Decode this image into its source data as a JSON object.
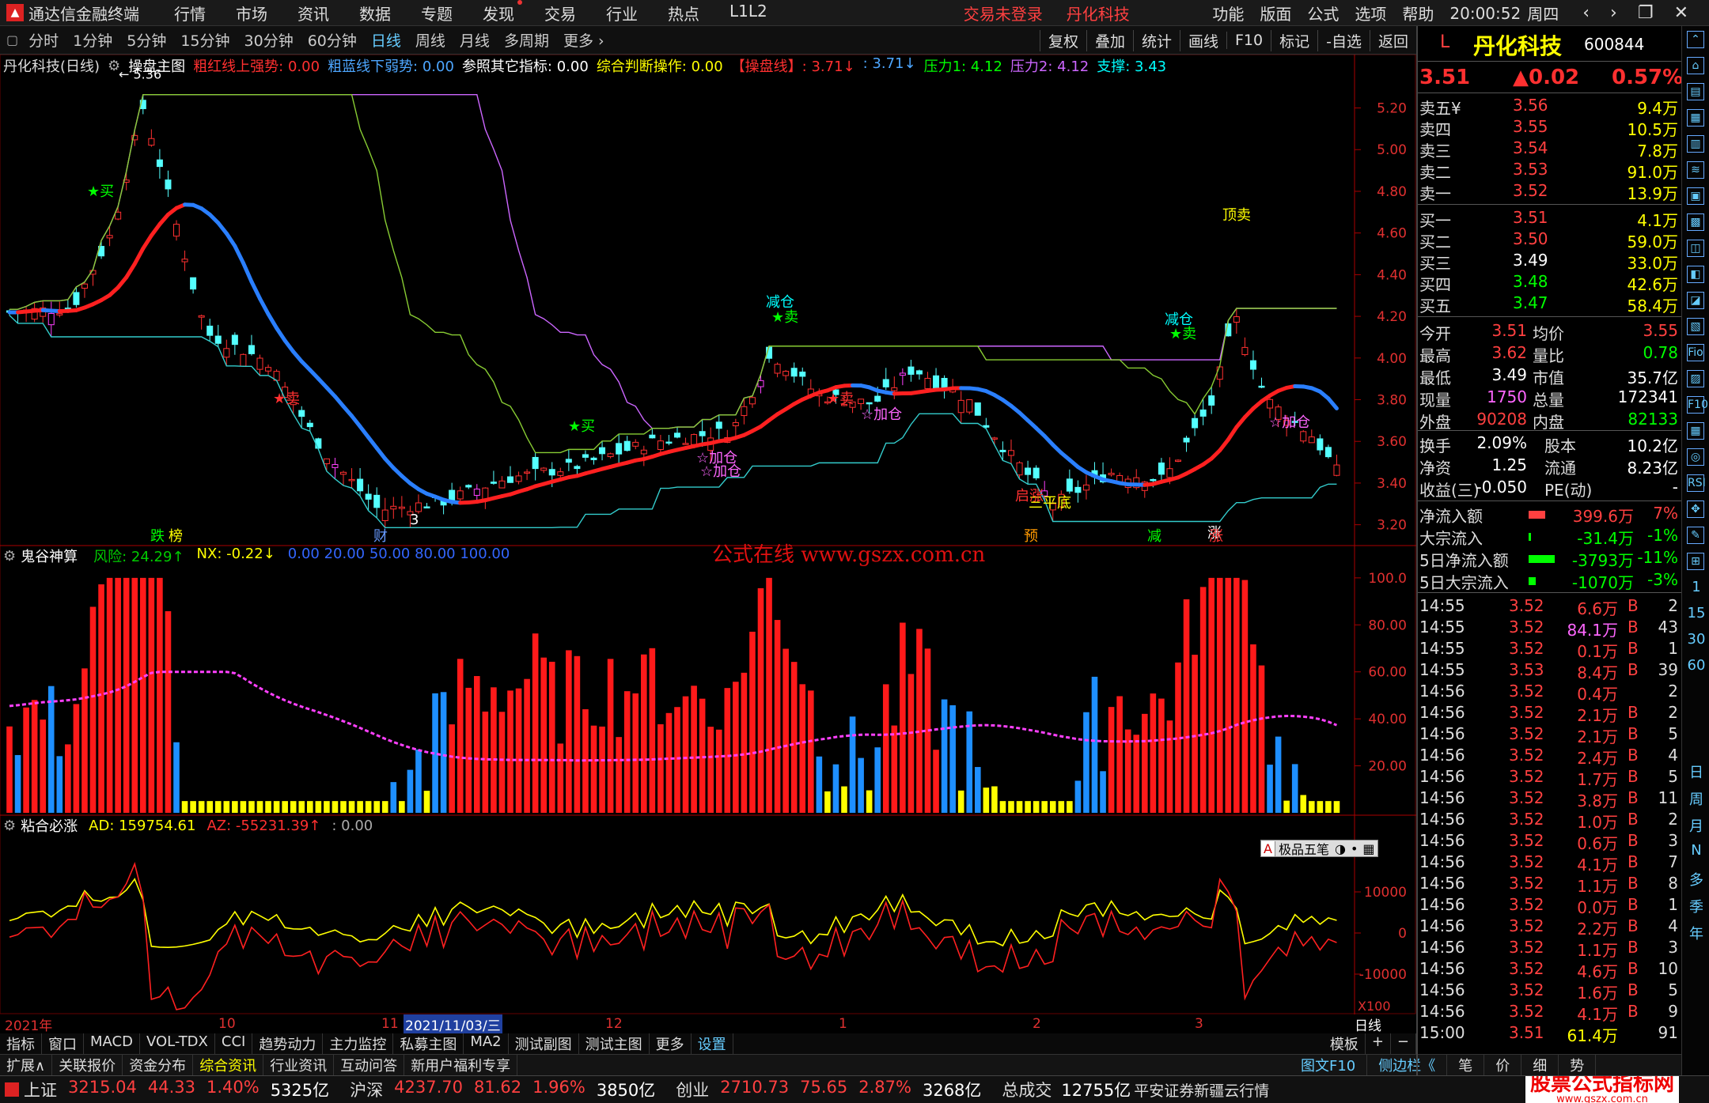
{
  "menubar": {
    "appname": "通达信金融终端",
    "items": [
      "行情",
      "市场",
      "资讯",
      "数据",
      "专题",
      "发现",
      "交易",
      "行业",
      "热点",
      "L1L2"
    ],
    "status_login": "交易未登录",
    "status_stock": "丹化科技",
    "right": [
      "功能",
      "版面",
      "公式",
      "选项",
      "帮助"
    ],
    "time": "20:00:52",
    "weekday": "周四",
    "controls": [
      "‹",
      "›",
      "❐",
      "✕"
    ]
  },
  "periodbar": {
    "items": [
      "分时",
      "1分钟",
      "5分钟",
      "15分钟",
      "30分钟",
      "60分钟",
      "日线",
      "周线",
      "月线",
      "多周期",
      "更多 ›"
    ],
    "active": "日线",
    "tools": [
      "复权",
      "叠加",
      "统计",
      "画线",
      "F10",
      "标记",
      "-自选",
      "返回"
    ]
  },
  "mainhdr": {
    "stock": "丹化科技(日线)",
    "formula": "操盘主图",
    "items": [
      {
        "t": "粗红线上强势: 0.00",
        "c": "#ff3030"
      },
      {
        "t": "粗蓝线下弱势: 0.00",
        "c": "#4da6ff"
      },
      {
        "t": "参照其它指标: 0.00",
        "c": "#ffffff"
      },
      {
        "t": "综合判断操作: 0.00",
        "c": "#ffff00"
      },
      {
        "t": "【操盘线】: 3.71↓",
        "c": "#ff3030"
      },
      {
        "t": ": 3.71↓",
        "c": "#4da6ff"
      },
      {
        "t": "压力1: 4.12",
        "c": "#00ff00"
      },
      {
        "t": "压力2: 4.12",
        "c": "#cc66ff"
      },
      {
        "t": "支撑: 3.43",
        "c": "#00ffff"
      }
    ]
  },
  "main_chart": {
    "y_ticks": [
      "5.20",
      "5.00",
      "4.80",
      "4.60",
      "4.40",
      "4.20",
      "4.00",
      "3.80",
      "3.60",
      "3.40",
      "3.20"
    ],
    "y_min": 3.1,
    "y_max": 5.35,
    "high_label": "5.36",
    "low_label": "3",
    "annotations": [
      {
        "t": "★买",
        "c": "#00ff00"
      },
      {
        "t": "★卖",
        "c": "#ff3030"
      },
      {
        "t": "★买",
        "c": "#00ff00"
      },
      {
        "t": "☆加仓",
        "c": "#ff66ff"
      },
      {
        "t": "☆加仓",
        "c": "#ff66ff"
      },
      {
        "t": "减仓",
        "c": "#00ffff"
      },
      {
        "t": "★卖",
        "c": "#00ff00"
      },
      {
        "t": "★卖",
        "c": "#ff3030"
      },
      {
        "t": "☆加仓",
        "c": "#ff66ff"
      },
      {
        "t": "三平底",
        "c": "#ffff00"
      },
      {
        "t": "减仓",
        "c": "#00ffff"
      },
      {
        "t": "★卖",
        "c": "#00ff00"
      },
      {
        "t": "顶卖",
        "c": "#ffff00"
      },
      {
        "t": "☆加仓",
        "c": "#ff66ff"
      },
      {
        "t": "启涨",
        "c": "#ff3030"
      },
      {
        "t": "3",
        "c": "#ffffff"
      },
      {
        "t": "涨",
        "c": "#ffffff"
      }
    ],
    "bottom_tags": [
      {
        "t": "跌",
        "c": "#00ff00"
      },
      {
        "t": "榜",
        "c": "#ffff00"
      },
      {
        "t": "财",
        "c": "#6699ff"
      },
      {
        "t": "预",
        "c": "#ff9900"
      },
      {
        "t": "减",
        "c": "#00ff00"
      },
      {
        "t": "涨",
        "c": "#ff3030"
      }
    ]
  },
  "osc1hdr": {
    "name": "鬼谷神算",
    "items": [
      {
        "t": "风险: 24.29↑",
        "c": "#00cc00"
      },
      {
        "t": "NX: -0.22↓",
        "c": "#ffff00"
      },
      {
        "t": "0.00  20.00  50.00  80.00  100.00",
        "c": "#3366ff"
      }
    ],
    "y_ticks": [
      "100.0",
      "80.00",
      "60.00",
      "40.00",
      "20.00"
    ],
    "watermark": "公式在线  www.gszx.com.cn"
  },
  "osc2hdr": {
    "name": "粘合必涨",
    "items": [
      {
        "t": "AD: 159754.61",
        "c": "#ffff00"
      },
      {
        "t": "AZ: -55231.39↑",
        "c": "#ff3030"
      },
      {
        "t": ": 0.00",
        "c": "#aaaaaa"
      }
    ],
    "y_ticks": [
      "10000",
      "0",
      "-10000"
    ],
    "unit": "X100",
    "popup": "极品五笔"
  },
  "datebar": {
    "labels": [
      "2021年",
      "10",
      "11",
      "2021/11/03/三",
      "12",
      "1",
      "2",
      "3"
    ],
    "right": "日线"
  },
  "bottomtabs": {
    "items": [
      "指标",
      "窗口",
      "MACD",
      "VOL-TDX",
      "CCI",
      "趋势动力",
      "主力监控",
      "私募主图",
      "MA2",
      "测试副图",
      "测试主图",
      "更多",
      "设置"
    ],
    "active": "设置",
    "right": [
      "模板",
      "+",
      "−"
    ]
  },
  "bottomtabs2": {
    "items": [
      "扩展∧",
      "关联报价",
      "资金分布",
      "综合资讯",
      "行业资讯",
      "互动问答",
      "新用户福利专享"
    ],
    "active": "综合资讯",
    "right": [
      "图文F10",
      "侧边栏《",
      "笔",
      "价",
      "细",
      "势"
    ]
  },
  "indexbar": {
    "items": [
      {
        "name": "上证",
        "v": "3215.04",
        "d": "44.33",
        "p": "1.40%",
        "a": "5325亿"
      },
      {
        "name": "沪深",
        "v": "4237.70",
        "d": "81.62",
        "p": "1.96%",
        "a": "3850亿"
      },
      {
        "name": "创业",
        "v": "2710.73",
        "d": "75.65",
        "p": "2.87%",
        "a": "3268亿"
      }
    ],
    "total_label": "总成交",
    "total": "12755亿",
    "broker": "平安证券新疆云行情",
    "brand": "股票公式指标网",
    "brand_url": "www.gszx.com.cn"
  },
  "quote": {
    "name": "丹化科技",
    "code": "600844",
    "flag": "L",
    "price": "3.51",
    "change": "▲0.02",
    "pct": "0.57%",
    "asks": [
      {
        "l": "卖五¥",
        "p": "3.56",
        "v": "9.4万",
        "c": "#ff4040"
      },
      {
        "l": "卖四",
        "p": "3.55",
        "v": "10.5万",
        "c": "#ff4040"
      },
      {
        "l": "卖三",
        "p": "3.54",
        "v": "7.8万",
        "c": "#ff4040"
      },
      {
        "l": "卖二",
        "p": "3.53",
        "v": "91.0万",
        "c": "#ff4040"
      },
      {
        "l": "卖一",
        "p": "3.52",
        "v": "13.9万",
        "c": "#ff4040"
      }
    ],
    "bids": [
      {
        "l": "买一",
        "p": "3.51",
        "v": "4.1万",
        "c": "#ff4040"
      },
      {
        "l": "买二",
        "p": "3.50",
        "v": "59.0万",
        "c": "#ff4040"
      },
      {
        "l": "买三",
        "p": "3.49",
        "v": "33.0万",
        "c": "#ffffff"
      },
      {
        "l": "买四",
        "p": "3.48",
        "v": "42.6万",
        "c": "#00ff00"
      },
      {
        "l": "买五",
        "p": "3.47",
        "v": "58.4万",
        "c": "#00ff00"
      }
    ],
    "stats": [
      {
        "l1": "今开",
        "v1": "3.51",
        "c1": "#ff4040",
        "l2": "均价",
        "v2": "3.55",
        "c2": "#ff4040"
      },
      {
        "l1": "最高",
        "v1": "3.62",
        "c1": "#ff4040",
        "l2": "量比",
        "v2": "0.78",
        "c2": "#00ff00"
      },
      {
        "l1": "最低",
        "v1": "3.49",
        "c1": "#ffffff",
        "l2": "市值",
        "v2": "35.7亿",
        "c2": "#ffffff"
      },
      {
        "l1": "现量",
        "v1": "1750",
        "c1": "#ff66ff",
        "l2": "总量",
        "v2": "172341",
        "c2": "#ffffff"
      },
      {
        "l1": "外盘",
        "v1": "90208",
        "c1": "#ff4040",
        "l2": "内盘",
        "v2": "82133",
        "c2": "#00ff00"
      }
    ],
    "stats2": [
      {
        "l1": "换手",
        "v1": "2.09%",
        "l2": "股本",
        "v2": "10.2亿"
      },
      {
        "l1": "净资",
        "v1": "1.25",
        "l2": "流通",
        "v2": "8.23亿"
      },
      {
        "l1": "收益(三)",
        "v1": "-0.050",
        "l2": "PE(动)",
        "v2": "-"
      }
    ],
    "flows": [
      {
        "l": "净流入额",
        "v": "399.6万",
        "p": "7%",
        "c": "#ff4040",
        "bar": 0.07
      },
      {
        "l": "大宗流入",
        "v": "-31.4万",
        "p": "-1%",
        "c": "#00ff00",
        "bar": 0.01
      },
      {
        "l": "5日净流入额",
        "v": "-3793万",
        "p": "-11%",
        "c": "#00ff00",
        "bar": 0.11
      },
      {
        "l": "5日大宗流入",
        "v": "-1070万",
        "p": "-3%",
        "c": "#00ff00",
        "bar": 0.03
      }
    ],
    "ticks": [
      [
        "14:55",
        "3.52",
        "6.6万",
        "B",
        "2",
        "#ff4040"
      ],
      [
        "14:55",
        "3.52",
        "84.1万",
        "B",
        "43",
        "#ff66ff"
      ],
      [
        "14:55",
        "3.52",
        "0.1万",
        "B",
        "1",
        "#ff4040"
      ],
      [
        "14:55",
        "3.53",
        "8.4万",
        "B",
        "39",
        "#ff4040"
      ],
      [
        "14:56",
        "3.52",
        "0.4万",
        "",
        "2",
        "#ff4040"
      ],
      [
        "14:56",
        "3.52",
        "2.1万",
        "B",
        "2",
        "#ff4040"
      ],
      [
        "14:56",
        "3.52",
        "2.1万",
        "B",
        "5",
        "#ff4040"
      ],
      [
        "14:56",
        "3.52",
        "2.4万",
        "B",
        "4",
        "#ff4040"
      ],
      [
        "14:56",
        "3.52",
        "1.7万",
        "B",
        "5",
        "#ff4040"
      ],
      [
        "14:56",
        "3.52",
        "3.8万",
        "B",
        "11",
        "#ff4040"
      ],
      [
        "14:56",
        "3.52",
        "1.0万",
        "B",
        "2",
        "#ff4040"
      ],
      [
        "14:56",
        "3.52",
        "0.6万",
        "B",
        "3",
        "#ff4040"
      ],
      [
        "14:56",
        "3.52",
        "4.1万",
        "B",
        "7",
        "#ff4040"
      ],
      [
        "14:56",
        "3.52",
        "1.1万",
        "B",
        "8",
        "#ff4040"
      ],
      [
        "14:56",
        "3.52",
        "0.0万",
        "B",
        "1",
        "#ff4040"
      ],
      [
        "14:56",
        "3.52",
        "2.2万",
        "B",
        "4",
        "#ff4040"
      ],
      [
        "14:56",
        "3.52",
        "1.1万",
        "B",
        "3",
        "#ff4040"
      ],
      [
        "14:56",
        "3.52",
        "4.6万",
        "B",
        "10",
        "#ff4040"
      ],
      [
        "14:56",
        "3.52",
        "1.6万",
        "B",
        "5",
        "#ff4040"
      ],
      [
        "14:56",
        "3.52",
        "4.1万",
        "B",
        "9",
        "#ff4040"
      ],
      [
        "15:00",
        "3.51",
        "61.4万",
        "",
        "91",
        "#ffff00"
      ]
    ]
  },
  "righticons": {
    "top": [
      "⌃",
      "⌂",
      "▤",
      "▦",
      "▥",
      "≋",
      "▣",
      "▩",
      "◫",
      "◧",
      "◪",
      "▧",
      "Fio",
      "▨",
      "F10",
      "▦",
      "◎",
      "RSI",
      "✥",
      "✎",
      "⊞",
      "1",
      "15",
      "30",
      "60"
    ],
    "bottom": [
      "日",
      "周",
      "月",
      "N",
      "多",
      "季",
      "年"
    ]
  }
}
